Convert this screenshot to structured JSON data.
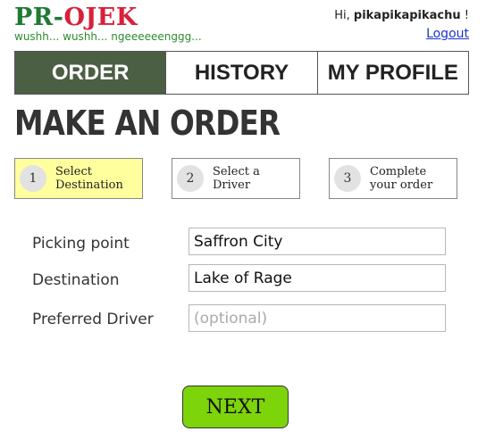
{
  "header": {
    "logo_pr": "PR",
    "logo_dash": "-",
    "logo_ojek": "OJEK",
    "tagline": "wushh... wushh... ngeeeeeenggg...",
    "greeting_prefix": "Hi, ",
    "username": "pikapikapikachu",
    "greeting_suffix": " !",
    "logout_label": "Logout"
  },
  "tabs": [
    {
      "label": "ORDER",
      "active": true
    },
    {
      "label": "HISTORY",
      "active": false
    },
    {
      "label": "MY PROFILE",
      "active": false
    }
  ],
  "page_title": "MAKE AN ORDER",
  "steps": [
    {
      "number": "1",
      "label_line1": "Select",
      "label_line2": "Destination",
      "active": true
    },
    {
      "number": "2",
      "label_line1": "Select a",
      "label_line2": "Driver",
      "active": false
    },
    {
      "number": "3",
      "label_line1": "Complete",
      "label_line2": "your order",
      "active": false
    }
  ],
  "form": {
    "picking_point": {
      "label": "Picking point",
      "value": "Saffron City"
    },
    "destination": {
      "label": "Destination",
      "value": "Lake of Rage"
    },
    "preferred_driver": {
      "label": "Preferred Driver",
      "value": "",
      "placeholder": "(optional)"
    }
  },
  "next_label": "NEXT",
  "colors": {
    "active_tab_bg": "#4b5f44",
    "active_step_bg": "#ffff9e",
    "next_button_bg": "#7ed40b",
    "logo_green": "#1f7a34",
    "logo_red": "#d8203b"
  }
}
